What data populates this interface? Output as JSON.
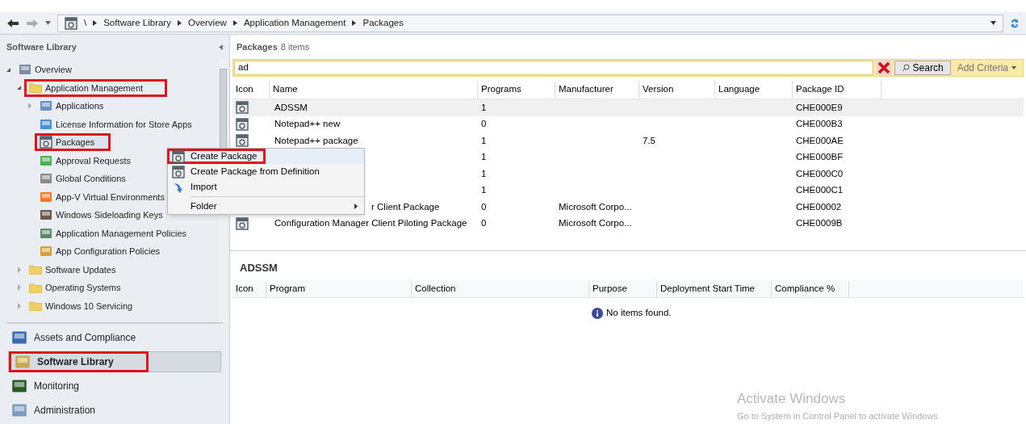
{
  "breadcrumb": [
    "\\",
    "Software Library",
    "Overview",
    "Application Management",
    "Packages"
  ],
  "sidebar": {
    "title": "Software Library",
    "tree": [
      {
        "label": "Overview",
        "expanded": true,
        "highlighted": false,
        "children": [
          {
            "label": "Application Management",
            "expanded": true,
            "highlighted": true,
            "children": [
              {
                "label": "Applications",
                "expanded": false,
                "highlighted": false
              },
              {
                "label": "License Information for Store Apps",
                "highlighted": false
              },
              {
                "label": "Packages",
                "highlighted": true,
                "selected": true
              },
              {
                "label": "Approval Requests",
                "highlighted": false
              },
              {
                "label": "Global Conditions",
                "highlighted": false
              },
              {
                "label": "App-V Virtual Environments",
                "highlighted": false
              },
              {
                "label": "Windows Sideloading Keys",
                "highlighted": false
              },
              {
                "label": "Application Management Policies",
                "highlighted": false
              },
              {
                "label": "App Configuration Policies",
                "highlighted": false
              }
            ]
          },
          {
            "label": "Software Updates",
            "expanded": false,
            "highlighted": false
          },
          {
            "label": "Operating Systems",
            "expanded": false,
            "highlighted": false
          },
          {
            "label": "Windows 10 Servicing",
            "expanded": false,
            "highlighted": false
          }
        ]
      }
    ],
    "workspaces": [
      {
        "label": "Assets and Compliance",
        "selected": false,
        "highlighted": false
      },
      {
        "label": "Software Library",
        "selected": true,
        "highlighted": true
      },
      {
        "label": "Monitoring",
        "selected": false,
        "highlighted": false
      },
      {
        "label": "Administration",
        "selected": false,
        "highlighted": false
      }
    ]
  },
  "list": {
    "title": "Packages",
    "count": "8 items",
    "search": {
      "value": "ad",
      "button": "Search",
      "add_criteria": "Add Criteria"
    },
    "columns": [
      "Icon",
      "Name",
      "Programs",
      "Manufacturer",
      "Version",
      "Language",
      "Package ID"
    ],
    "rows": [
      {
        "name": "ADSSM",
        "programs": "1",
        "package_id": "CHE000E9",
        "selected": true,
        "covered": false
      },
      {
        "name": "Notepad++ new",
        "programs": "0",
        "package_id": "CHE000B3",
        "selected": false,
        "covered": false
      },
      {
        "name": "Notepad++ package",
        "programs": "1",
        "version": "7.5",
        "package_id": "CHE000AE",
        "selected": false,
        "covered": false
      },
      {
        "programs": "1",
        "package_id": "CHE000BF",
        "selected": false
      },
      {
        "programs": "1",
        "package_id": "CHE000C0",
        "selected": false
      },
      {
        "programs": "1",
        "package_id": "CHE000C1",
        "selected": false
      },
      {
        "name": "r Client Package",
        "programs": "0",
        "manufacturer": "Microsoft Corpo...",
        "package_id": "CHE00002",
        "selected": false,
        "covered": true
      },
      {
        "name": "Configuration Manager Client Piloting Package",
        "programs": "0",
        "manufacturer": "Microsoft Corpo...",
        "package_id": "CHE0009B",
        "selected": false,
        "covered": false
      }
    ]
  },
  "context_menu": [
    {
      "label": "Create Package",
      "highlighted": true,
      "hovered": true,
      "submenu": false
    },
    {
      "label": "Create Package from Definition",
      "highlighted": false,
      "hovered": false,
      "submenu": false
    },
    {
      "label": "Import",
      "highlighted": false,
      "hovered": false,
      "submenu": false
    },
    {
      "label": "Folder",
      "highlighted": false,
      "hovered": false,
      "submenu": true
    }
  ],
  "details": {
    "title": "ADSSM",
    "columns": [
      "Icon",
      "Program",
      "Collection",
      "Purpose",
      "Deployment Start Time",
      "Compliance %"
    ],
    "empty": "No items found."
  },
  "activation": {
    "title": "Activate Windows",
    "text": "Go to System in Control Panel to activate Windows"
  }
}
